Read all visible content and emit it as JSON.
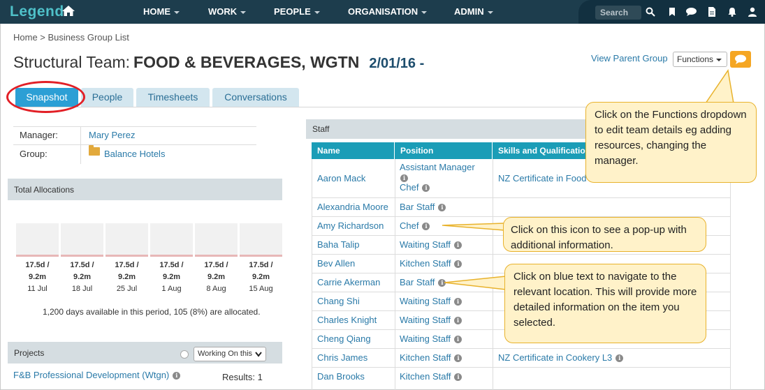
{
  "app": {
    "logo": "Legend"
  },
  "nav": [
    {
      "label": "HOME"
    },
    {
      "label": "WORK"
    },
    {
      "label": "PEOPLE"
    },
    {
      "label": "ORGANISATION"
    },
    {
      "label": "ADMIN"
    }
  ],
  "search": {
    "label": "Search"
  },
  "breadcrumb": "Home > Business Group List",
  "page": {
    "title_prefix": "Structural Team:",
    "title_name": "FOOD & BEVERAGES, WGTN",
    "date": "2/01/16 -",
    "view_parent": "View Parent Group",
    "functions_label": "Functions"
  },
  "tabs": [
    {
      "label": "Snapshot",
      "active": true
    },
    {
      "label": "People"
    },
    {
      "label": "Timesheets"
    },
    {
      "label": "Conversations"
    }
  ],
  "details": {
    "manager_label": "Manager:",
    "manager_value": "Mary Perez",
    "group_label": "Group:",
    "group_value": "Balance Hotels"
  },
  "allocations": {
    "title": "Total Allocations",
    "columns": [
      {
        "top": "17.5d /",
        "mid": "9.2m",
        "date": "11 Jul"
      },
      {
        "top": "17.5d /",
        "mid": "9.2m",
        "date": "18 Jul"
      },
      {
        "top": "17.5d /",
        "mid": "9.2m",
        "date": "25 Jul"
      },
      {
        "top": "17.5d /",
        "mid": "9.2m",
        "date": "1 Aug"
      },
      {
        "top": "17.5d /",
        "mid": "9.2m",
        "date": "8 Aug"
      },
      {
        "top": "17.5d /",
        "mid": "9.2m",
        "date": "15 Aug"
      }
    ],
    "summary": "1,200 days available in this period, 105 (8%) are allocated."
  },
  "projects": {
    "title": "Projects",
    "filter": "Working On this",
    "item": "F&B Professional Development (Wtgn)",
    "results": "Results: 1"
  },
  "staff": {
    "title": "Staff",
    "headers": [
      "Name",
      "Position",
      "Skills and Qualifications"
    ],
    "rows": [
      {
        "name": "Aaron Mack",
        "position": "Assistant Manager",
        "position2": "Chef",
        "skills": "NZ Certificate in Food"
      },
      {
        "name": "Alexandria Moore",
        "position": "Bar Staff",
        "skills": ""
      },
      {
        "name": "Amy Richardson",
        "position": "Chef",
        "skills": ""
      },
      {
        "name": "Baha Talip",
        "position": "Waiting Staff",
        "skills": ""
      },
      {
        "name": "Bev Allen",
        "position": "Kitchen Staff",
        "skills": ""
      },
      {
        "name": "Carrie Akerman",
        "position": "Bar Staff",
        "skills": ""
      },
      {
        "name": "Chang Shi",
        "position": "Waiting Staff",
        "skills": ""
      },
      {
        "name": "Charles Knight",
        "position": "Waiting Staff",
        "skills": ""
      },
      {
        "name": "Cheng Qiang",
        "position": "Waiting Staff",
        "skills": ""
      },
      {
        "name": "Chris James",
        "position": "Kitchen Staff",
        "skills": "NZ Certificate in Cookery L3"
      },
      {
        "name": "Dan Brooks",
        "position": "Kitchen Staff",
        "skills": ""
      }
    ]
  },
  "callouts": {
    "functions": "Click on the Functions dropdown to edit team details eg adding resources, changing the manager.",
    "info_icon": "Click on this icon to see a pop-up with additional information.",
    "blue_text": "Click on blue text to navigate to the relevant location. This will provide more detailed information on the item you selected."
  },
  "colors": {
    "nav_bg": "#1d3d4d",
    "accent": "#2c9fd5",
    "table_header": "#1b9db7",
    "link": "#2a7aa8",
    "callout_bg": "#fff2c9",
    "callout_border": "#e8b22c",
    "highlight_oval": "#e21f26"
  }
}
